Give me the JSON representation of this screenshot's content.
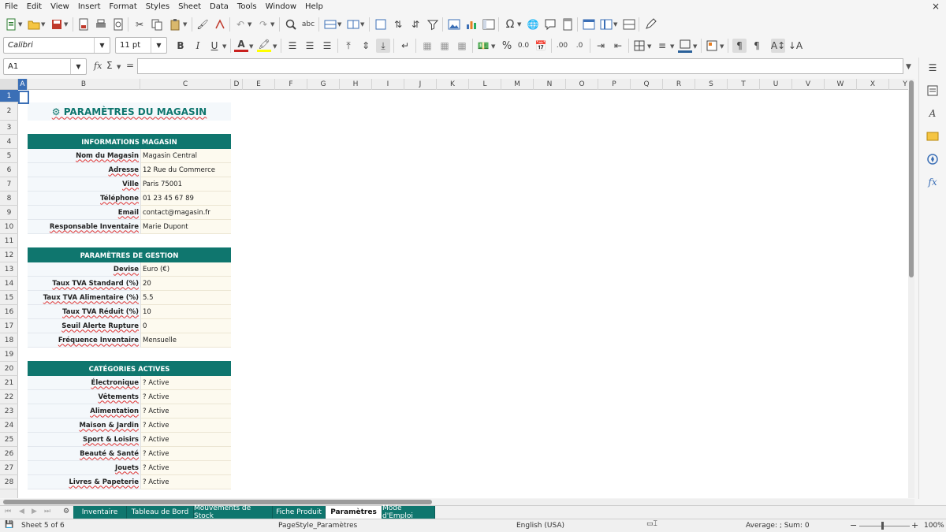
{
  "menu": [
    "File",
    "Edit",
    "View",
    "Insert",
    "Format",
    "Styles",
    "Sheet",
    "Data",
    "Tools",
    "Window",
    "Help"
  ],
  "close_symbol": "×",
  "font": {
    "name": "Calibri",
    "size": "11 pt"
  },
  "formula": {
    "cell_ref": "A1",
    "fx": "fx",
    "sum": "Σ",
    "equals": "=",
    "content": ""
  },
  "format_labels": {
    "bold": "B",
    "italic": "I",
    "underline": "U",
    "font_color": "A",
    "percent": "%",
    "decimal": "0.0"
  },
  "columns": [
    "A",
    "B",
    "C",
    "D",
    "E",
    "F",
    "G",
    "H",
    "I",
    "J",
    "K",
    "L",
    "M",
    "N",
    "O",
    "P",
    "Q",
    "R",
    "S",
    "T",
    "U",
    "V",
    "W",
    "X",
    "Y"
  ],
  "rows": [
    "1",
    "2",
    "3",
    "4",
    "5",
    "6",
    "7",
    "8",
    "9",
    "10",
    "11",
    "12",
    "13",
    "14",
    "15",
    "16",
    "17",
    "18",
    "19",
    "20",
    "21",
    "22",
    "23",
    "24",
    "25",
    "26",
    "27",
    "28"
  ],
  "sheet": {
    "title": "⚙ PARAMÈTRES DU MAGASIN",
    "sections": [
      {
        "header": "INFORMATIONS MAGASIN",
        "rows": [
          {
            "label": "Nom du Magasin",
            "value": "Magasin Central"
          },
          {
            "label": "Adresse",
            "value": "12 Rue du Commerce"
          },
          {
            "label": "Ville",
            "value": "Paris 75001"
          },
          {
            "label": "Téléphone",
            "value": "01 23 45 67 89"
          },
          {
            "label": "Email",
            "value": "contact@magasin.fr"
          },
          {
            "label": "Responsable Inventaire",
            "value": "Marie Dupont"
          }
        ]
      },
      {
        "header": "PARAMÈTRES DE GESTION",
        "rows": [
          {
            "label": "Devise",
            "value": "Euro (€)"
          },
          {
            "label": "Taux TVA Standard (%)",
            "value": "20"
          },
          {
            "label": "Taux TVA Alimentaire (%)",
            "value": "5.5"
          },
          {
            "label": "Taux TVA Réduit (%)",
            "value": "10"
          },
          {
            "label": "Seuil Alerte Rupture",
            "value": "0"
          },
          {
            "label": "Fréquence Inventaire",
            "value": "Mensuelle"
          }
        ]
      },
      {
        "header": "CATÉGORIES ACTIVES",
        "rows": [
          {
            "label": "Électronique",
            "value": "? Active"
          },
          {
            "label": "Vêtements",
            "value": "? Active"
          },
          {
            "label": "Alimentation",
            "value": "? Active"
          },
          {
            "label": "Maison & Jardin",
            "value": "? Active"
          },
          {
            "label": "Sport & Loisirs",
            "value": "? Active"
          },
          {
            "label": "Beauté & Santé",
            "value": "? Active"
          },
          {
            "label": "Jouets",
            "value": "? Active"
          },
          {
            "label": "Livres & Papeterie",
            "value": "? Active"
          }
        ]
      }
    ]
  },
  "tabs": [
    {
      "label": "Inventaire"
    },
    {
      "label": "Tableau de Bord"
    },
    {
      "label": "Mouvements de Stock"
    },
    {
      "label": "Fiche Produit"
    },
    {
      "label": "Paramètres"
    },
    {
      "label": "Mode d'Emploi"
    }
  ],
  "tab_nav_symbol": "⚙",
  "status": {
    "sheet": "Sheet 5 of 6",
    "page_style": "PageStyle_Paramètres",
    "language": "English (USA)",
    "summary": "Average: ; Sum: 0",
    "zoom": "100%",
    "zoom_minus": "−",
    "zoom_plus": "+"
  },
  "colors": {
    "accent": "#0f766e",
    "label_bg": "#f4f8fb",
    "value_bg": "#fdfaef",
    "title_color": "#0f766e"
  }
}
